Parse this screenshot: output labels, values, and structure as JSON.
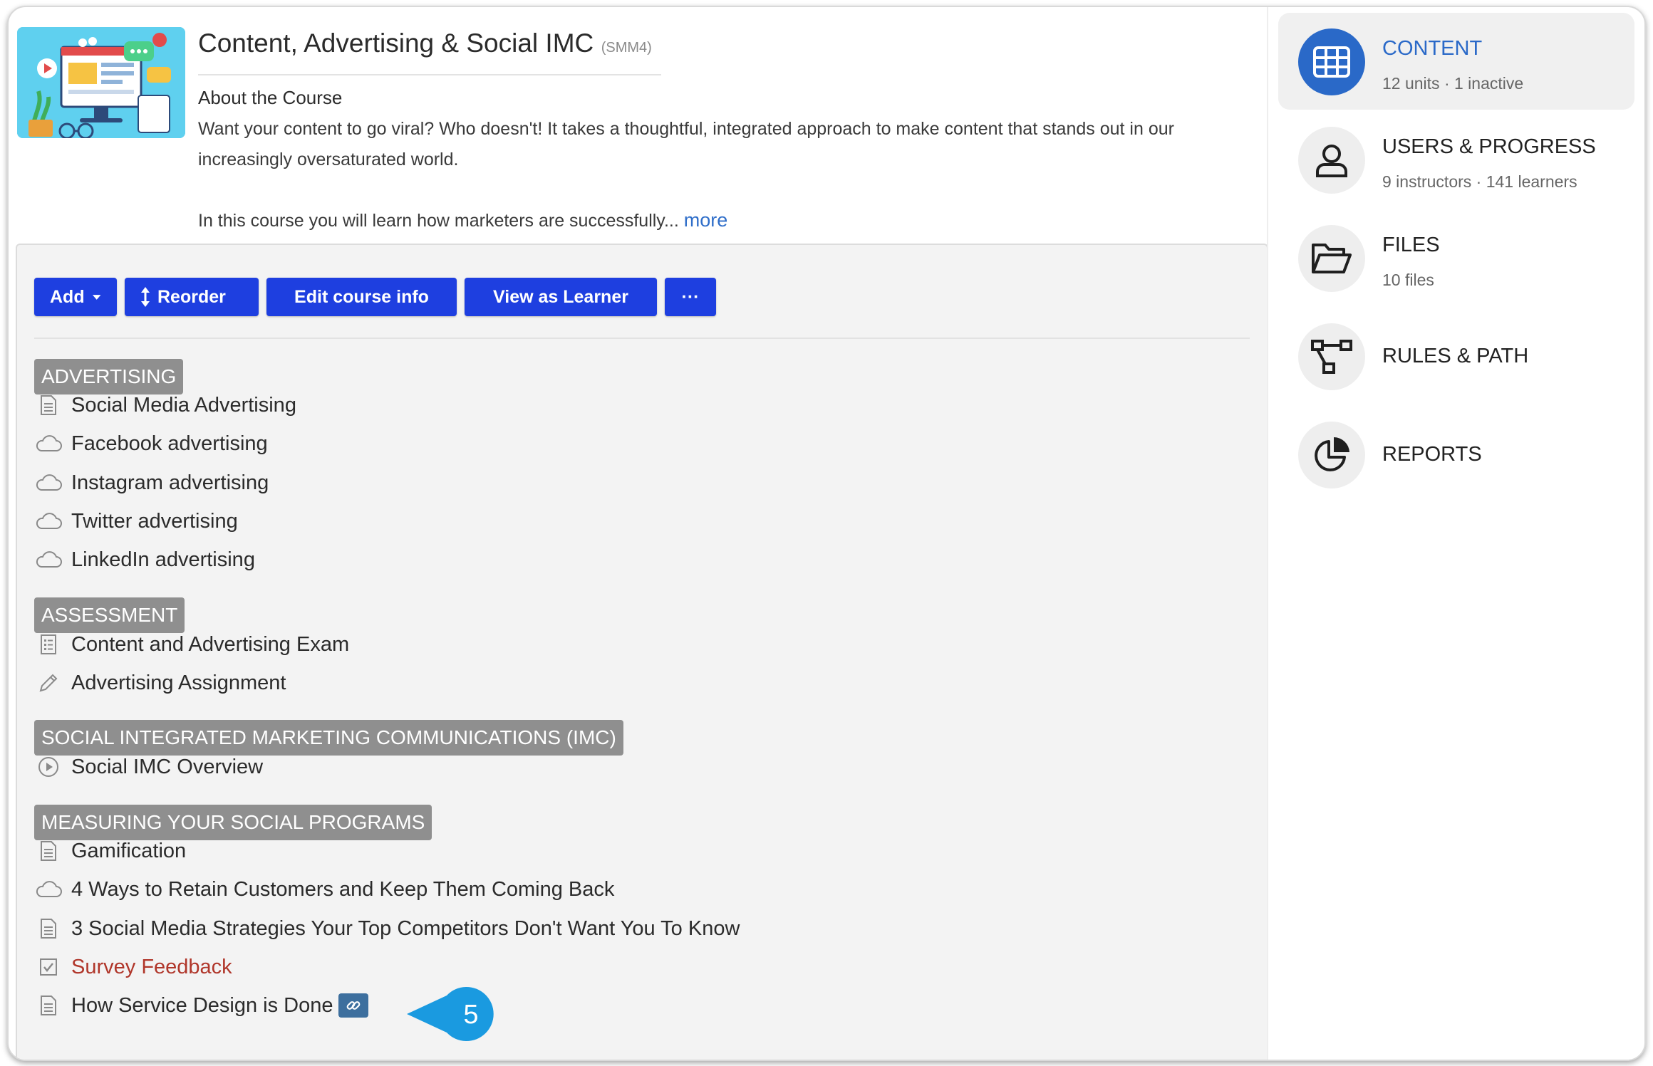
{
  "course": {
    "title": "Content, Advertising & Social IMC",
    "code": "(SMM4)",
    "about_heading": "About the Course",
    "description_p1": "Want your content to go viral? Who doesn't! It takes a thoughtful, integrated approach to make content that stands out in our increasingly oversaturated world.",
    "description_p2": "In this course you will learn how marketers are successfully...",
    "more_link": "more"
  },
  "toolbar": {
    "add": "Add",
    "reorder": "Reorder",
    "edit": "Edit course info",
    "view": "View as Learner",
    "more": "···"
  },
  "sections": [
    {
      "title": "ADVERTISING",
      "items": [
        {
          "label": "Social Media Advertising",
          "icon": "document-icon"
        },
        {
          "label": "Facebook advertising",
          "icon": "cloud-icon"
        },
        {
          "label": "Instagram advertising",
          "icon": "cloud-icon"
        },
        {
          "label": "Twitter advertising",
          "icon": "cloud-icon"
        },
        {
          "label": "LinkedIn advertising",
          "icon": "cloud-icon"
        }
      ]
    },
    {
      "title": "ASSESSMENT",
      "items": [
        {
          "label": "Content and Advertising Exam",
          "icon": "checklist-icon"
        },
        {
          "label": "Advertising Assignment",
          "icon": "pencil-icon"
        }
      ]
    },
    {
      "title": "SOCIAL INTEGRATED MARKETING COMMUNICATIONS (IMC)",
      "items": [
        {
          "label": "Social IMC Overview",
          "icon": "play-circle-icon"
        }
      ]
    },
    {
      "title": "MEASURING YOUR SOCIAL PROGRAMS",
      "items": [
        {
          "label": "Gamification",
          "icon": "document-icon"
        },
        {
          "label": "4 Ways to Retain Customers and Keep Them Coming Back",
          "icon": "cloud-icon"
        },
        {
          "label": "3 Social Media Strategies Your Top Competitors Don't Want You To Know",
          "icon": "document-icon"
        },
        {
          "label": "Survey Feedback",
          "icon": "checkbox-icon",
          "color": "#b0362a"
        },
        {
          "label": "How Service Design is Done",
          "icon": "document-icon",
          "badge": "link-icon"
        }
      ]
    }
  ],
  "callout": {
    "number": "5",
    "color": "#1a9ae0"
  },
  "nav": [
    {
      "title": "CONTENT",
      "subtitle": "12 units · 1 inactive",
      "icon": "grid-icon",
      "active": true
    },
    {
      "title": "USERS & PROGRESS",
      "subtitle": "9 instructors · 141 learners",
      "icon": "user-icon"
    },
    {
      "title": "FILES",
      "subtitle": "10 files",
      "icon": "folder-open-icon"
    },
    {
      "title": "RULES & PATH",
      "subtitle": "",
      "icon": "flow-icon"
    },
    {
      "title": "REPORTS",
      "subtitle": "",
      "icon": "pie-chart-icon"
    }
  ],
  "colors": {
    "accent": "#1e3fe0",
    "nav_active": "#2a69c8",
    "section_bg": "#8f8f8f",
    "link": "#2f6ec9"
  }
}
